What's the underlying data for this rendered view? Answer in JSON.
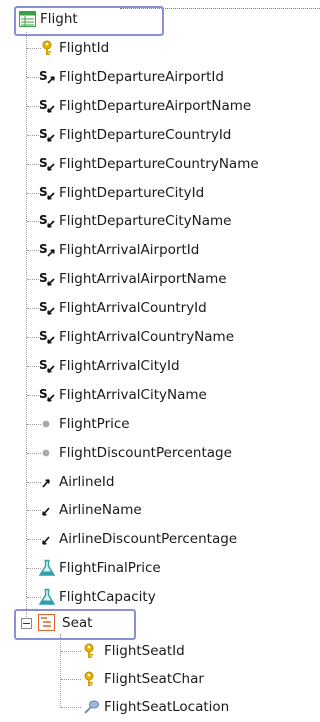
{
  "tree": {
    "root": {
      "label": "Flight",
      "icon": "transaction-table-icon"
    },
    "attributes": [
      {
        "label": "FlightId",
        "icon": "key-icon"
      },
      {
        "label": "FlightDepartureAirportId",
        "icon": "subtype-key-icon"
      },
      {
        "label": "FlightDepartureAirportName",
        "icon": "subtype-inferred-icon"
      },
      {
        "label": "FlightDepartureCountryId",
        "icon": "subtype-inferred-icon"
      },
      {
        "label": "FlightDepartureCountryName",
        "icon": "subtype-inferred-icon"
      },
      {
        "label": "FlightDepartureCityId",
        "icon": "subtype-inferred-icon"
      },
      {
        "label": "FlightDepartureCityName",
        "icon": "subtype-inferred-icon"
      },
      {
        "label": "FlightArrivalAirportId",
        "icon": "subtype-key-icon"
      },
      {
        "label": "FlightArrivalAirportName",
        "icon": "subtype-inferred-icon"
      },
      {
        "label": "FlightArrivalCountryId",
        "icon": "subtype-inferred-icon"
      },
      {
        "label": "FlightArrivalCountryName",
        "icon": "subtype-inferred-icon"
      },
      {
        "label": "FlightArrivalCityId",
        "icon": "subtype-inferred-icon"
      },
      {
        "label": "FlightArrivalCityName",
        "icon": "subtype-inferred-icon"
      },
      {
        "label": "FlightPrice",
        "icon": "attribute-dot-icon"
      },
      {
        "label": "FlightDiscountPercentage",
        "icon": "attribute-dot-icon"
      },
      {
        "label": "AirlineId",
        "icon": "foreign-key-arrow-icon"
      },
      {
        "label": "AirlineName",
        "icon": "inferred-arrow-icon"
      },
      {
        "label": "AirlineDiscountPercentage",
        "icon": "inferred-arrow-icon"
      },
      {
        "label": "FlightFinalPrice",
        "icon": "formula-flask-icon"
      },
      {
        "label": "FlightCapacity",
        "icon": "formula-flask-icon"
      }
    ],
    "level": {
      "label": "Seat",
      "icon": "subtransaction-level-icon",
      "expander": "collapse-minus-icon",
      "attributes": [
        {
          "label": "FlightSeatId",
          "icon": "key-icon"
        },
        {
          "label": "FlightSeatChar",
          "icon": "key-icon"
        },
        {
          "label": "FlightSeatLocation",
          "icon": "domain-pin-icon"
        }
      ]
    }
  },
  "colors": {
    "selection_border": "#8891d8",
    "key_gold": "#e0a800",
    "flask_teal": "#2f9fa8",
    "level_orange": "#e0632a",
    "table_green": "#3aa046"
  }
}
